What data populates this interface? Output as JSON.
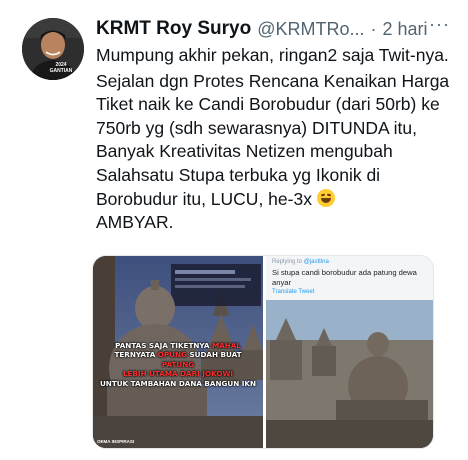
{
  "tweet": {
    "author_name": "KRMT Roy Suryo",
    "author_handle": "@KRMTRo...",
    "separator": "·",
    "time": "2 hari",
    "more": "···",
    "avatar_badge": "2024\nGANTIAN",
    "paragraph_1": "Mumpung akhir pekan, ringan2 saja Twit-nya.",
    "paragraph_2": "Sejalan dgn Protes Rencana Kenaikan Harga Tiket naik ke Candi Borobudur (dari 50rb) ke 750rb yg (sdh sewarasnya) DITUNDA itu, Banyak Kreativitas Netizen mengubah Salahsatu Stupa terbuka yg Ikonik di Borobudur itu, LUCU, he-3x",
    "emoji": "rolling-on-floor-laughing-emoji",
    "paragraph_3": "AMBYAR."
  },
  "media": {
    "left_image": {
      "caption_1": "PANTAS SAJA TIKETNYA",
      "caption_1_red": "MAHAL",
      "caption_2": "TERNYATA",
      "caption_2_red": "OPUNG",
      "caption_2b": "SUDAH BUAT",
      "caption_2c_red": "PATUNG",
      "caption_3_red": "LEBIH UTAMA DARI JOKOWI",
      "caption_4": "UNTUK TAMBAHAN DANA BANGUN IKN",
      "watermark": "OEMA INSPIRASI"
    },
    "right_image": {
      "reply_prefix": "Replying to",
      "reply_handle": "@jasttina",
      "text": "Si stupa candi borobudur ada patung dewa anyar",
      "translate": "Translate Tweet"
    }
  }
}
